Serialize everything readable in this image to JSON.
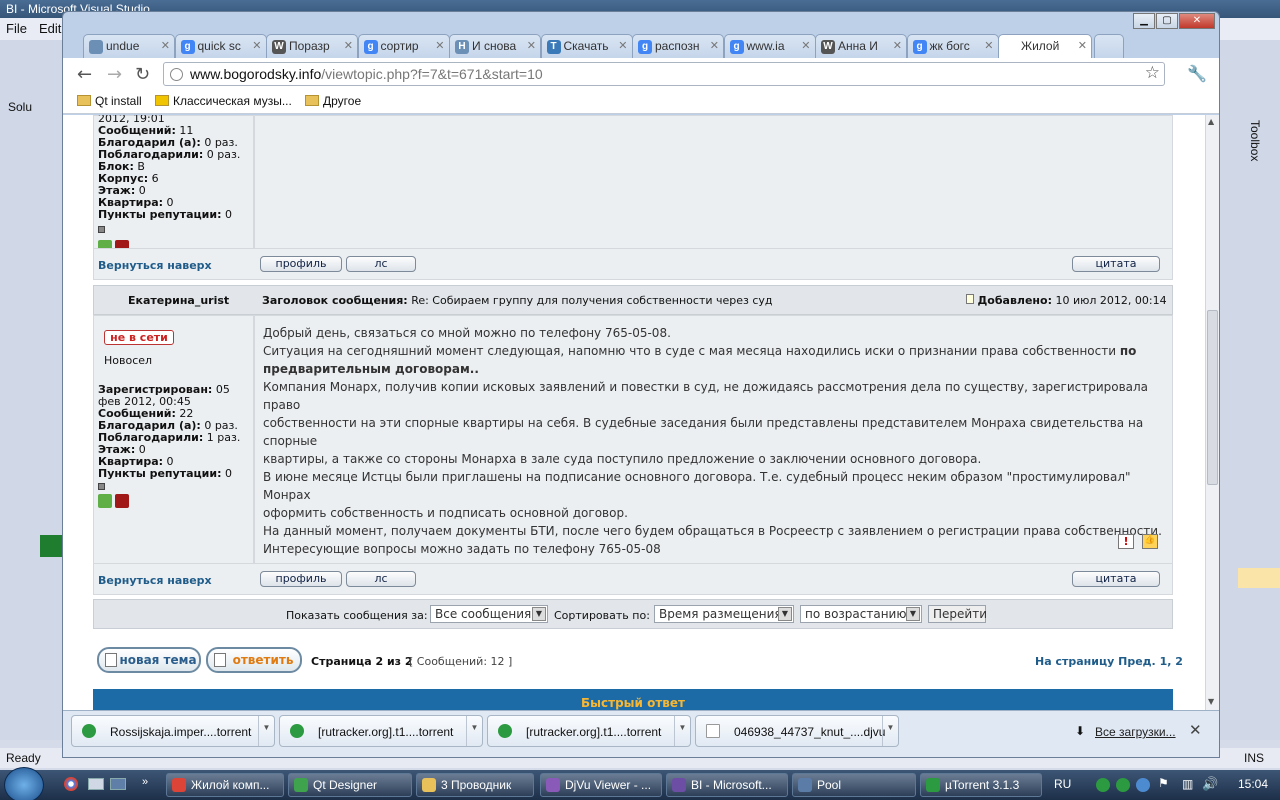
{
  "vs": {
    "title": "BI - Microsoft Visual Studio",
    "menu": [
      "File",
      "Edit"
    ],
    "status_left": "Ready",
    "status_right": "INS",
    "solution_label": "Solu",
    "toolbox_label": "Toolbox"
  },
  "chrome": {
    "tabs": [
      {
        "label": "undue",
        "icon": "page-icon",
        "color": "#6b8fb5"
      },
      {
        "label": "quick sc",
        "icon": "google-icon",
        "color": "#4285f4"
      },
      {
        "label": "Поразр",
        "icon": "wikipedia-icon",
        "color": "#555555"
      },
      {
        "label": "сортир",
        "icon": "google-icon",
        "color": "#4285f4"
      },
      {
        "label": "И снова",
        "icon": "habr-icon",
        "color": "#6b8fb5"
      },
      {
        "label": "Скачать",
        "icon": "t-icon",
        "color": "#3a7ab8"
      },
      {
        "label": "распозн",
        "icon": "google-icon",
        "color": "#4285f4"
      },
      {
        "label": "www.ia",
        "icon": "google-icon",
        "color": "#4285f4"
      },
      {
        "label": "Анна И",
        "icon": "wikipedia-icon",
        "color": "#555555"
      },
      {
        "label": "жк богс",
        "icon": "google-icon",
        "color": "#4285f4"
      },
      {
        "label": "Жилой",
        "icon": "page-icon",
        "color": "#ffffff",
        "active": true
      }
    ],
    "url_host": "www.bogorodsky.info",
    "url_path": "/viewtopic.php?f=7&t=671&start=10",
    "bookmarks": [
      "Qt install",
      "Классическая музы...",
      "Другое"
    ]
  },
  "post1": {
    "date_tail": "2012, 19:01",
    "stats": [
      {
        "label": "Сообщений:",
        "value": "11"
      },
      {
        "label": "Благодарил (а):",
        "value": "0 раз."
      },
      {
        "label": "Поблагодарили:",
        "value": "0 раз."
      },
      {
        "label": "Блок:",
        "value": "В"
      },
      {
        "label": "Корпус:",
        "value": "6"
      },
      {
        "label": "Этаж:",
        "value": "0"
      },
      {
        "label": "Квартира:",
        "value": "0"
      },
      {
        "label": "Пункты репутации:",
        "value": "0"
      }
    ]
  },
  "links": {
    "back_top": "Вернуться наверх",
    "profile": "профиль",
    "pm": "лс",
    "quote": "цитата"
  },
  "post2": {
    "author": "Екатерина_urist",
    "subject_label": "Заголовок сообщения:",
    "subject": "Re: Собираем группу для получения собственности через суд",
    "added_label": "Добавлено:",
    "added": "10 июл 2012, 00:14",
    "status": "не в сети",
    "rank": "Новосел",
    "registered_label": "Зарегистрирован:",
    "registered": "05 фев 2012, 00:45",
    "stats": [
      {
        "label": "Сообщений:",
        "value": "22"
      },
      {
        "label": "Благодарил (а):",
        "value": "0 раз."
      },
      {
        "label": "Поблагодарили:",
        "value": "1 раз."
      },
      {
        "label": "Этаж:",
        "value": "0"
      },
      {
        "label": "Квартира:",
        "value": "0"
      },
      {
        "label": "Пункты репутации:",
        "value": "0"
      }
    ],
    "line1": "Добрый день, связаться со мной можно по телефону 765-05-08.",
    "line2a": "Ситуация на сегодняшний момент следующая, напомню что в суде с мая месяца находились иски о признании права собственности ",
    "line2b": "по",
    "line3": "предварительным договорам..",
    "line4": "Компания Монарх, получив копии исковых заявлений и повестки в суд, не дожидаясь рассмотрения дела по существу, зарегистрировала право",
    "line5": "собственности на эти спорные квартиры на себя. В судебные заседания были представлены представителем Монраха свидетельства на спорные",
    "line6": "квартиры, а также со стороны Монарха в зале суда поступило предложение о заключении основного договора.",
    "line7": "В июне месяце Истцы были приглашены на подписание основного договора. Т.е. судебный процесс неким образом \"простимулировал\" Монрах",
    "line8": "оформить собственность и подписать основной договор.",
    "line9": "На данный момент, получаем документы БТИ, после чего будем обращаться в Росреестр с заявлением о регистрации права собственности.",
    "line10": "Интересующие вопросы можно задать по телефону 765-05-08"
  },
  "sortbar": {
    "show_label": "Показать сообщения за:",
    "show_value": "Все сообщения",
    "sort_label": "Сортировать по:",
    "sort_value": "Время размещения",
    "order_value": "по возрастанию",
    "go": "Перейти"
  },
  "pager": {
    "new_topic": "новая тема",
    "reply": "ответить",
    "page_info": "Страница 2 из 2",
    "count": "[ Сообщений: 12 ]",
    "goto": "На страницу Пред.",
    "pages": "1, 2"
  },
  "quick_reply": "Быстрый ответ",
  "downloads": {
    "items": [
      "Rossijskaja.imper....torrent",
      "[rutracker.org].t1....torrent",
      "[rutracker.org].t1....torrent",
      "046938_44737_knut_....djvu"
    ],
    "all": "Все загрузки..."
  },
  "taskbar": {
    "items": [
      "Жилой комп...",
      "Qt Designer",
      "3 Проводник",
      "DjVu Viewer - ...",
      "BI - Microsoft...",
      "Pool",
      "µTorrent 3.1.3"
    ],
    "lang": "RU",
    "clock": "15:04"
  }
}
